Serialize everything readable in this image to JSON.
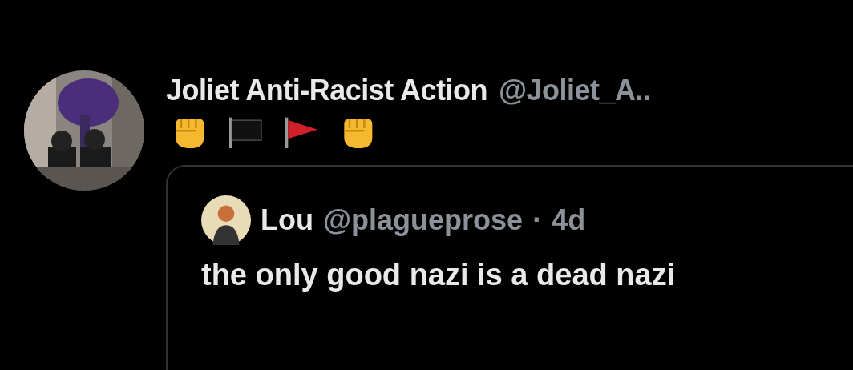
{
  "post": {
    "author": "Joliet Anti-Racist Action",
    "handle": "@Joliet_A..",
    "emoji": [
      {
        "kind": "fist"
      },
      {
        "kind": "flag",
        "color": "#111111"
      },
      {
        "kind": "flag",
        "color": "#d0202a"
      },
      {
        "kind": "fist"
      }
    ],
    "quote": {
      "author": "Lou",
      "handle": "@plagueprose",
      "separator": "·",
      "time": "4d",
      "text": "the only good nazi is a dead nazi"
    }
  }
}
